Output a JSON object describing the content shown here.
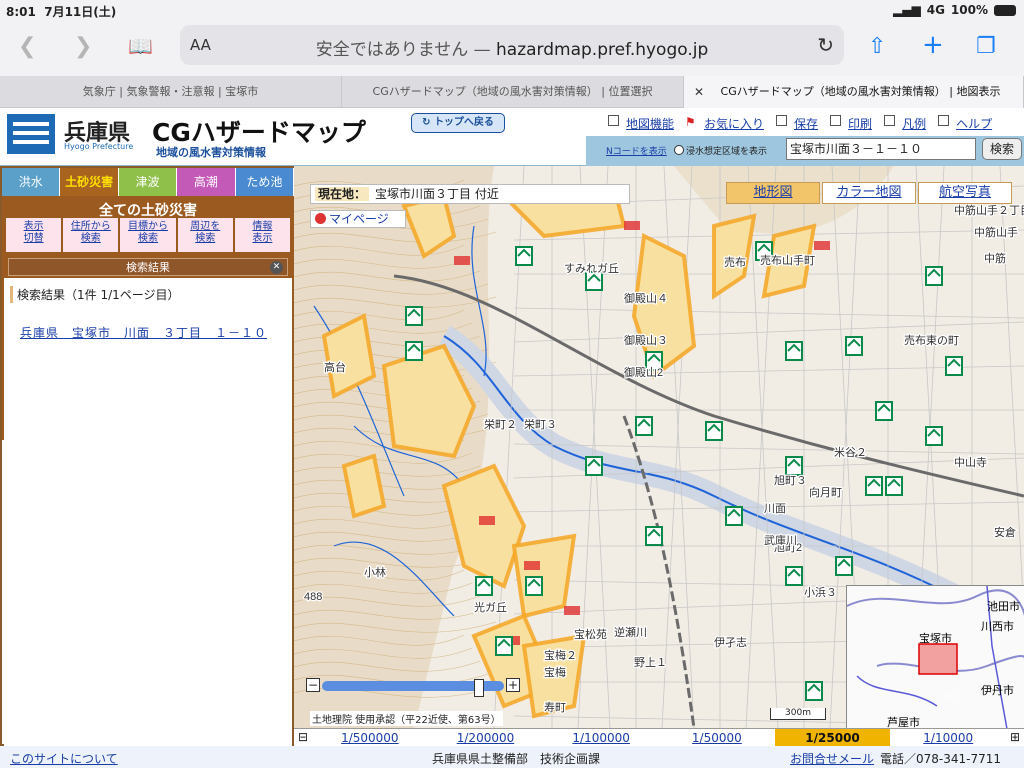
{
  "status_bar": {
    "time": "8:01",
    "date": "7月11日(土)",
    "network": "4G",
    "battery": "100%"
  },
  "browser": {
    "text_size": "AA",
    "address_prefix": "安全ではありません —",
    "address_domain": "hazardmap.pref.hyogo.jp",
    "tabs": [
      {
        "label": "気象庁 | 気象警報・注意報 | 宝塚市",
        "active": false
      },
      {
        "label": "CGハザードマップ（地域の風水害対策情報） | 位置選択",
        "active": false
      },
      {
        "label": "CGハザードマップ（地域の風水害対策情報）  | 地図表示",
        "active": true
      }
    ]
  },
  "header": {
    "pref_name": "兵庫県",
    "pref_name_en": "Hyogo Prefecture",
    "title": "CGハザードマップ",
    "subtitle": "地域の風水害対策情報",
    "top_back": "トップへ戻る",
    "menu": [
      "地図機能",
      "お気に入り",
      "保存",
      "印刷",
      "凡例",
      "ヘルプ"
    ],
    "ncode_link": "Nコードを表示",
    "flood_checkbox": "浸水想定区域を表示",
    "address_value": "宝塚市川面３－１－１０",
    "search_button": "検索"
  },
  "sidebar": {
    "hazard_tabs": [
      {
        "label": "洪水",
        "color": "#5aa0c8"
      },
      {
        "label": "土砂災害",
        "color": "#a8641f",
        "active": true
      },
      {
        "label": "津波",
        "color": "#8fc04a"
      },
      {
        "label": "高潮",
        "color": "#c35ab8"
      },
      {
        "label": "ため池",
        "color": "#4a8ad0"
      }
    ],
    "category_title": "全ての土砂災害",
    "buttons": [
      "表示\n切替",
      "住所から\n検索",
      "目標から\n検索",
      "周辺を\n検索",
      "情報\n表示"
    ],
    "result_header": "検索結果",
    "result_count": "検索結果（1件 1/1ページ目）",
    "result_item": "兵庫県　宝塚市　川面　３丁目　１－１０"
  },
  "map": {
    "current_location_label": "現在地：",
    "current_location": "宝塚市川面３丁目 付近",
    "mypage": "マイページ",
    "map_types": [
      {
        "label": "地形図",
        "active": true
      },
      {
        "label": "カラー地図",
        "active": false
      },
      {
        "label": "航空写真",
        "active": false
      }
    ],
    "place_labels": [
      "すみれガ丘",
      "売布山手町",
      "中筋山手２丁目",
      "中筋山手",
      "中筋",
      "売布東の町",
      "御殿山４",
      "御殿山３",
      "御殿山2",
      "栄町３",
      "栄町２",
      "旭町３",
      "旭町2",
      "向月町",
      "川面",
      "武庫川",
      "伊孑志",
      "逆瀬川",
      "光ガ丘",
      "宝松苑",
      "高台",
      "宝梅２",
      "宝梅",
      "野上１",
      "米谷２",
      "寿町",
      "売布",
      "小浜３",
      "小林",
      "中山寺",
      "安倉",
      "488",
      "川西市"
    ],
    "credit": "土地理院 使用承認（平22近使、第63号）",
    "scale_label": "300m",
    "minimap_labels": [
      "宝塚市",
      "川西市",
      "池田市",
      "伊丹市",
      "芦屋市",
      "171"
    ],
    "colors": {
      "hazard_fill": "#f8e0a0",
      "hazard_border": "#f5a623",
      "danger": "#e03030",
      "shelter": "#0a8a4a",
      "road": "#6a6a6a",
      "river": "#1e64d8"
    }
  },
  "scale_bar": {
    "options": [
      "1/500000",
      "1/200000",
      "1/100000",
      "1/50000",
      "1/25000",
      "1/10000"
    ],
    "selected": "1/25000"
  },
  "footer": {
    "about": "このサイトについて",
    "dept": "兵庫県県土整備部　技術企画課",
    "mail": "お問合せメール",
    "tel": "電話／078-341-7711"
  }
}
